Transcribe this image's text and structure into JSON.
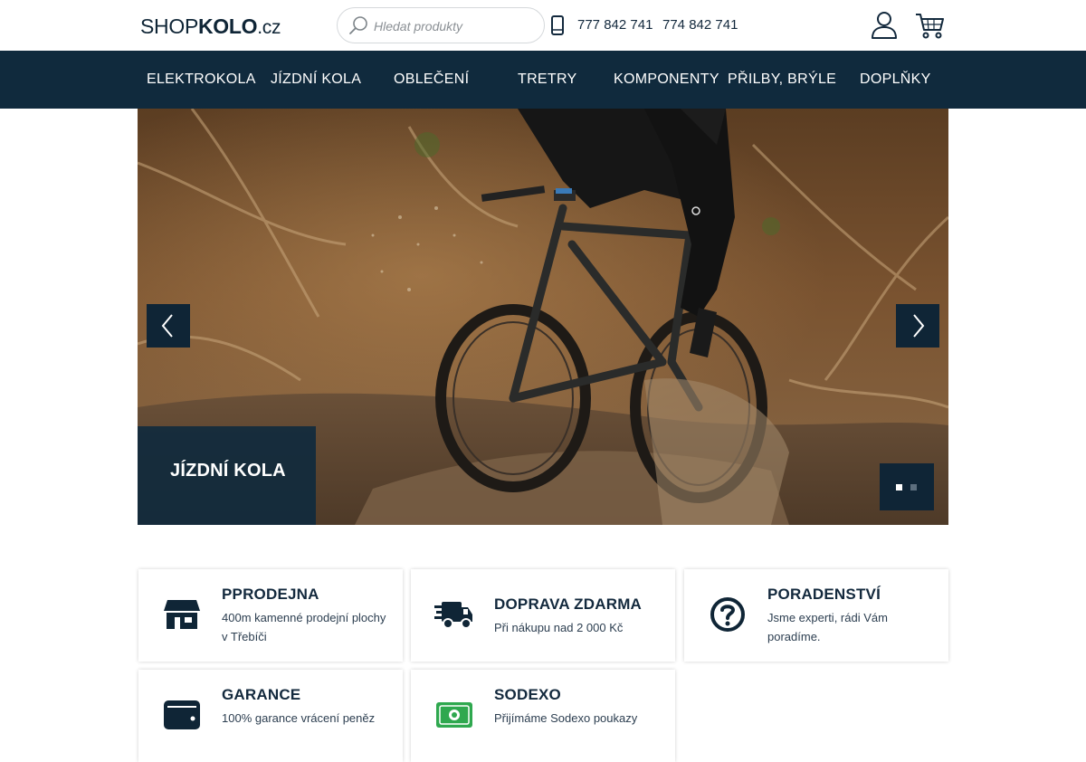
{
  "logo": {
    "part1": "SHOP",
    "part2": "KOLO",
    "part3": ".cz"
  },
  "search": {
    "placeholder": "Hledat produkty"
  },
  "contact": {
    "phone1": "777 842 741",
    "phone2": "774 842 741"
  },
  "nav": [
    "ELEKTROKOLA",
    "JÍZDNÍ KOLA",
    "OBLEČENÍ",
    "TRETRY",
    "KOMPONENTY",
    "PŘILBY, BRÝLE",
    "DOPLŇKY"
  ],
  "hero": {
    "caption": "JÍZDNÍ KOLA",
    "slides_total": 2,
    "active_slide": 1
  },
  "features": [
    {
      "title": "PPRODEJNA",
      "desc": "400m kamenné prodejní plochy v Třebíči",
      "icon": "store-icon"
    },
    {
      "title": "DOPRAVA ZDARMA",
      "desc": "Při nákupu nad 2 000 Kč",
      "icon": "truck-icon"
    },
    {
      "title": "PORADENSTVÍ",
      "desc": "Jsme experti, rádi Vám poradíme.",
      "icon": "question-icon"
    },
    {
      "title": "GARANCE",
      "desc": "100% garance vrácení peněz",
      "icon": "wallet-icon"
    },
    {
      "title": "SODEXO",
      "desc": "Přijímáme Sodexo poukazy",
      "icon": "money-icon"
    }
  ],
  "colors": {
    "primary": "#102a3d",
    "text": "#13293d",
    "accent": "#0f2536"
  }
}
